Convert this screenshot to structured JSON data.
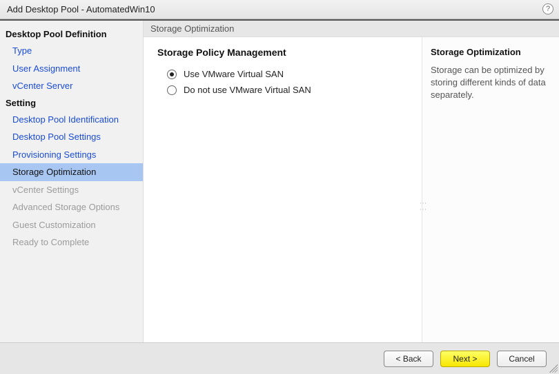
{
  "window": {
    "title": "Add Desktop Pool - AutomatedWin10"
  },
  "sidebar": {
    "section1": {
      "label": "Desktop Pool Definition"
    },
    "items1": [
      {
        "label": "Type"
      },
      {
        "label": "User Assignment"
      },
      {
        "label": "vCenter Server"
      }
    ],
    "section2": {
      "label": "Setting"
    },
    "items2": [
      {
        "label": "Desktop Pool Identification"
      },
      {
        "label": "Desktop Pool Settings"
      },
      {
        "label": "Provisioning Settings"
      },
      {
        "label": "Storage Optimization"
      },
      {
        "label": "vCenter Settings"
      },
      {
        "label": "Advanced Storage Options"
      },
      {
        "label": "Guest Customization"
      },
      {
        "label": "Ready to Complete"
      }
    ]
  },
  "breadcrumb": "Storage Optimization",
  "policy": {
    "heading": "Storage Policy Management",
    "option1": "Use VMware Virtual SAN",
    "option2": "Do not use VMware Virtual SAN"
  },
  "help": {
    "heading": "Storage Optimization",
    "body": "Storage can be optimized by storing different kinds of data separately."
  },
  "footer": {
    "back": "< Back",
    "next": "Next >",
    "cancel": "Cancel"
  }
}
